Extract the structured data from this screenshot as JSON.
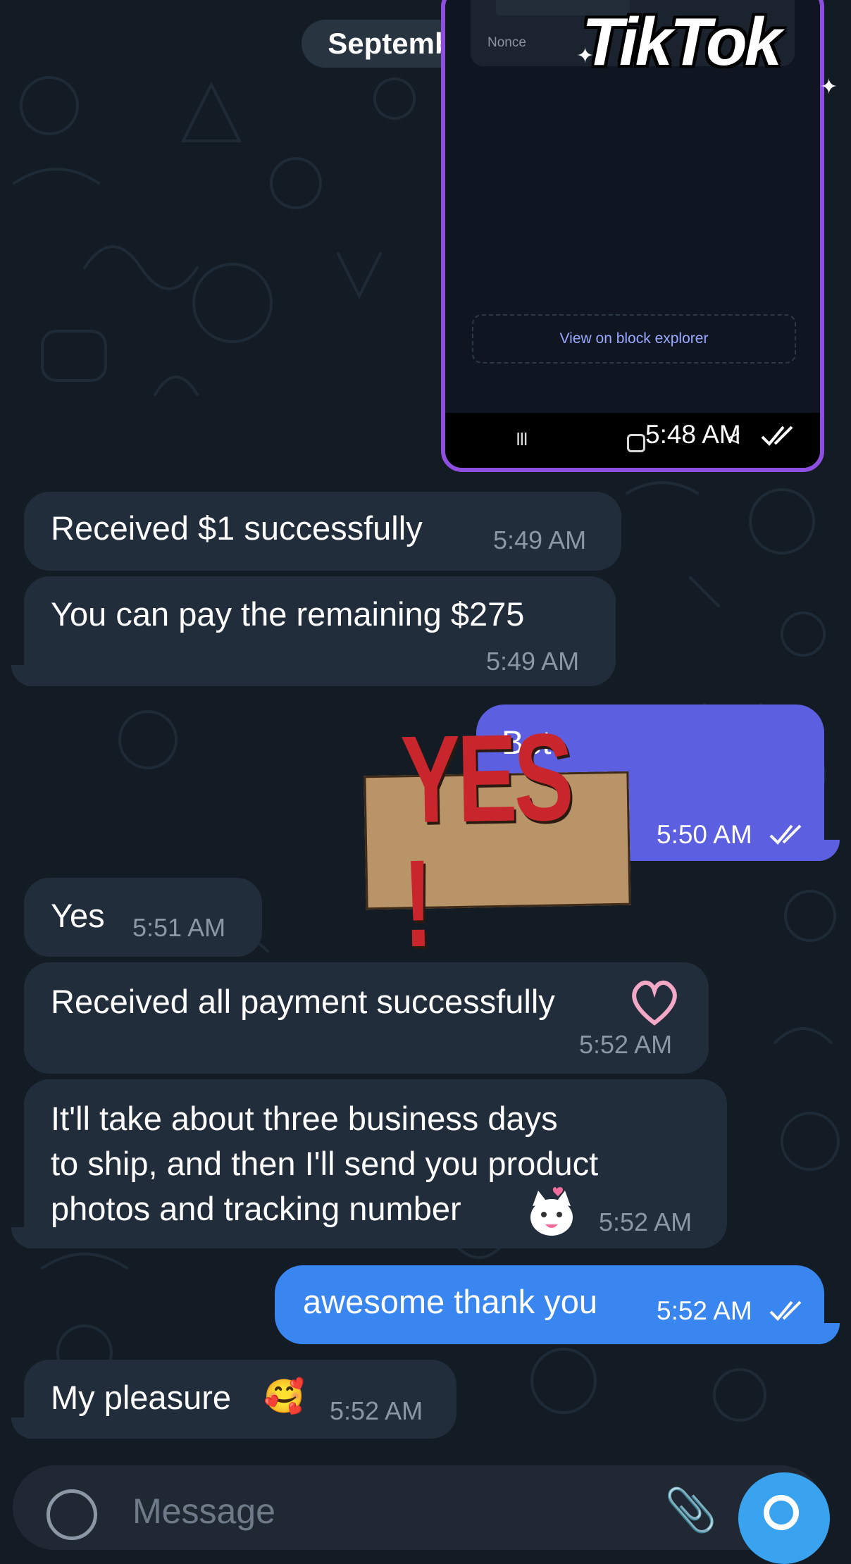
{
  "date_separator": "September 13",
  "watermark": "TikTok",
  "screenshot_message": {
    "nonce_label": "Nonce",
    "explorer_link": "View on block explorer",
    "nav_recents": "III",
    "nav_back": "<",
    "time": "5:48 AM"
  },
  "messages": [
    {
      "id": 1,
      "direction": "incoming",
      "text": "Received $1 successfully",
      "time": "5:49 AM"
    },
    {
      "id": 2,
      "direction": "incoming",
      "text": "You can pay the remaining $275",
      "time": "5:49 AM"
    },
    {
      "id": 3,
      "direction": "outgoing",
      "text": "Bet",
      "time": "5:50 AM",
      "read": true
    },
    {
      "id": 4,
      "direction": "incoming",
      "text": "Yes",
      "time": "5:51 AM"
    },
    {
      "id": 5,
      "direction": "incoming",
      "text": "Received all payment successfully",
      "time": "5:52 AM"
    },
    {
      "id": 6,
      "direction": "incoming",
      "lines": [
        "It'll take about three business days",
        "to ship, and then I'll send you product",
        "photos and tracking number"
      ],
      "time": "5:52 AM"
    },
    {
      "id": 7,
      "direction": "outgoing",
      "text": "awesome thank you",
      "time": "5:52 AM",
      "read": true
    },
    {
      "id": 8,
      "direction": "incoming",
      "text": "My pleasure",
      "emoji": "🥰",
      "time": "5:52 AM"
    }
  ],
  "sticker": {
    "text": "YES !"
  },
  "composer": {
    "placeholder": "Message"
  },
  "colors": {
    "background": "#131c24",
    "incoming_bubble": "#222d3b",
    "outgoing_purple": "#5b5fe0",
    "outgoing_blue": "#3a86f0",
    "screenshot_border": "#8e4fe0",
    "send_button": "#3aa3f0"
  },
  "icons": [
    "double-check-icon",
    "emoji-icon",
    "attach-icon",
    "send-icon",
    "heart-sticker-icon",
    "cat-sticker-icon"
  ]
}
